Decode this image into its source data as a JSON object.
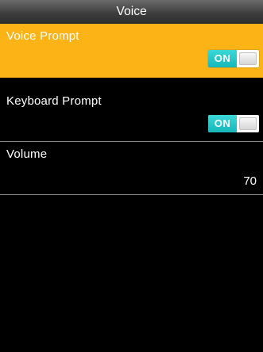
{
  "header": {
    "title": "Voice"
  },
  "settings": [
    {
      "label": "Voice Prompt",
      "toggle": "ON",
      "selected": true
    },
    {
      "label": "Keyboard Prompt",
      "toggle": "ON",
      "selected": false
    },
    {
      "label": "Volume",
      "value": "70",
      "selected": false
    }
  ],
  "colors": {
    "selected_row": "#fcb316",
    "title_bar": "#3e3e3e",
    "toggle_on": "#16b6b9",
    "background": "#000000"
  },
  "icons": {
    "toggle_knob": "toggle-knob-icon"
  }
}
